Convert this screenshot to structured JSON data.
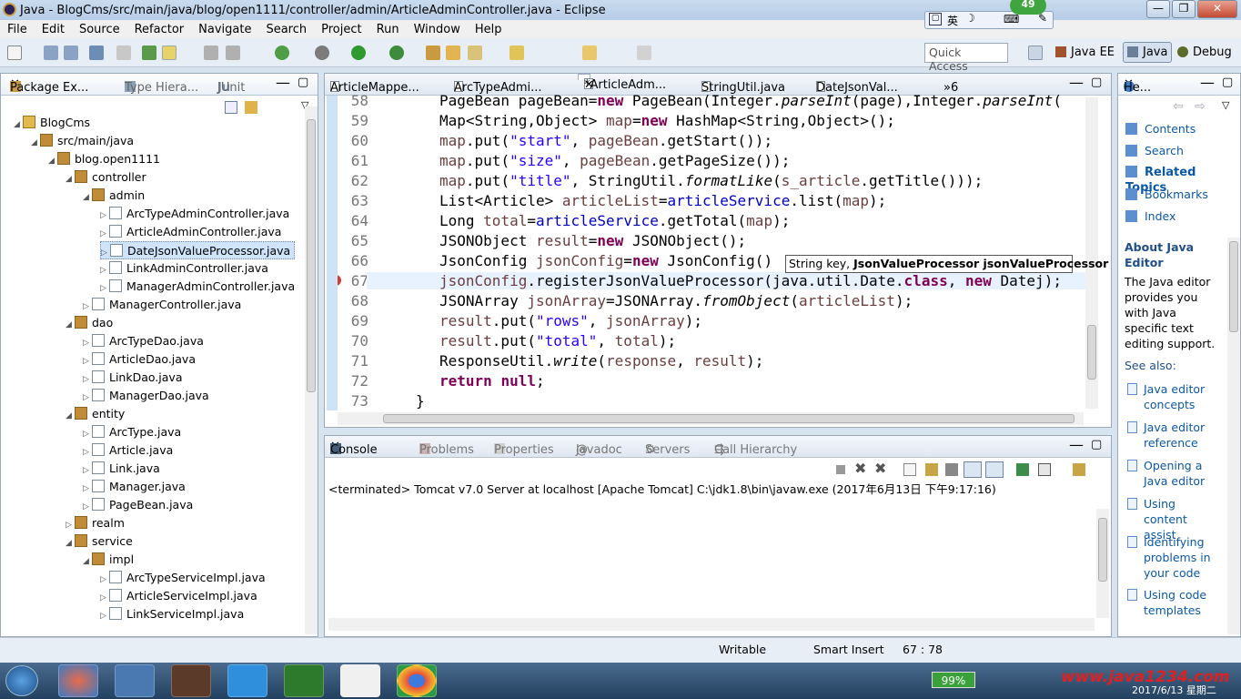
{
  "window": {
    "title": "Java - BlogCms/src/main/java/blog/open1111/controller/admin/ArticleAdminController.java - Eclipse"
  },
  "menu": [
    "File",
    "Edit",
    "Source",
    "Refactor",
    "Navigate",
    "Search",
    "Project",
    "Run",
    "Window",
    "Help"
  ],
  "quick_access": {
    "placeholder": "Quick Access"
  },
  "perspectives": [
    "Java EE",
    "Java",
    "Debug"
  ],
  "ime": {
    "label": "英",
    "badge": "49"
  },
  "package_explorer": {
    "tabs": [
      "Package Ex...",
      "Type Hiera...",
      "JUnit"
    ],
    "tree": [
      {
        "label": "BlogCms",
        "depth": 0,
        "kind": "proj",
        "open": true
      },
      {
        "label": "src/main/java",
        "depth": 1,
        "kind": "pkg",
        "open": true
      },
      {
        "label": "blog.open1111",
        "depth": 2,
        "kind": "pkg",
        "open": true
      },
      {
        "label": "controller",
        "depth": 3,
        "kind": "pkg",
        "open": true
      },
      {
        "label": "admin",
        "depth": 4,
        "kind": "pkg",
        "open": true
      },
      {
        "label": "ArcTypeAdminController.java",
        "depth": 5,
        "kind": "jf"
      },
      {
        "label": "ArticleAdminController.java",
        "depth": 5,
        "kind": "jf"
      },
      {
        "label": "DateJsonValueProcessor.java",
        "depth": 5,
        "kind": "jf",
        "selected": true
      },
      {
        "label": "LinkAdminController.java",
        "depth": 5,
        "kind": "jf"
      },
      {
        "label": "ManagerAdminController.java",
        "depth": 5,
        "kind": "jf"
      },
      {
        "label": "ManagerController.java",
        "depth": 4,
        "kind": "jf"
      },
      {
        "label": "dao",
        "depth": 3,
        "kind": "pkg",
        "open": true
      },
      {
        "label": "ArcTypeDao.java",
        "depth": 4,
        "kind": "jf"
      },
      {
        "label": "ArticleDao.java",
        "depth": 4,
        "kind": "jf"
      },
      {
        "label": "LinkDao.java",
        "depth": 4,
        "kind": "jf"
      },
      {
        "label": "ManagerDao.java",
        "depth": 4,
        "kind": "jf"
      },
      {
        "label": "entity",
        "depth": 3,
        "kind": "pkg",
        "open": true
      },
      {
        "label": "ArcType.java",
        "depth": 4,
        "kind": "jf"
      },
      {
        "label": "Article.java",
        "depth": 4,
        "kind": "jf"
      },
      {
        "label": "Link.java",
        "depth": 4,
        "kind": "jf"
      },
      {
        "label": "Manager.java",
        "depth": 4,
        "kind": "jf"
      },
      {
        "label": "PageBean.java",
        "depth": 4,
        "kind": "jf"
      },
      {
        "label": "realm",
        "depth": 3,
        "kind": "pkg"
      },
      {
        "label": "service",
        "depth": 3,
        "kind": "pkg",
        "open": true
      },
      {
        "label": "impl",
        "depth": 4,
        "kind": "pkg",
        "open": true
      },
      {
        "label": "ArcTypeServiceImpl.java",
        "depth": 5,
        "kind": "jf"
      },
      {
        "label": "ArticleServiceImpl.java",
        "depth": 5,
        "kind": "jf"
      },
      {
        "label": "LinkServiceImpl.java",
        "depth": 5,
        "kind": "jf"
      }
    ]
  },
  "editor": {
    "tabs": [
      "ArticleMappe...",
      "ArcTypeAdmi...",
      "*ArticleAdm...",
      "StringUtil.java",
      "DateJsonVal...",
      "»6"
    ],
    "lines": [
      {
        "n": "58",
        "t": [
          [
            "PageBean pageBean=",
            "n"
          ],
          [
            "new",
            "kw"
          ],
          [
            " PageBean(Integer.",
            "n"
          ],
          [
            "parseInt",
            "it"
          ],
          [
            "(page),Integer.",
            "n"
          ],
          [
            "parseInt",
            "it"
          ],
          [
            "(",
            "n"
          ]
        ]
      },
      {
        "n": "59",
        "t": [
          [
            "Map<String,Object> ",
            "n"
          ],
          [
            "map",
            "lv"
          ],
          [
            "=",
            "n"
          ],
          [
            "new",
            "kw"
          ],
          [
            " HashMap<String,Object>();",
            "n"
          ]
        ]
      },
      {
        "n": "60",
        "t": [
          [
            "map",
            "lv"
          ],
          [
            ".put(",
            "n"
          ],
          [
            "\"start\"",
            "st"
          ],
          [
            ", ",
            "n"
          ],
          [
            "pageBean",
            "lv"
          ],
          [
            ".getStart());",
            "n"
          ]
        ]
      },
      {
        "n": "61",
        "t": [
          [
            "map",
            "lv"
          ],
          [
            ".put(",
            "n"
          ],
          [
            "\"size\"",
            "st"
          ],
          [
            ", ",
            "n"
          ],
          [
            "pageBean",
            "lv"
          ],
          [
            ".getPageSize());",
            "n"
          ]
        ]
      },
      {
        "n": "62",
        "t": [
          [
            "map",
            "lv"
          ],
          [
            ".put(",
            "n"
          ],
          [
            "\"title\"",
            "st"
          ],
          [
            ", StringUtil.",
            "n"
          ],
          [
            "formatLike",
            "it"
          ],
          [
            "(",
            "n"
          ],
          [
            "s_article",
            "lv"
          ],
          [
            ".getTitle()));",
            "n"
          ]
        ]
      },
      {
        "n": "63",
        "t": [
          [
            "List<Article> ",
            "n"
          ],
          [
            "articleList",
            "lv"
          ],
          [
            "=",
            "n"
          ],
          [
            "articleService",
            "fv"
          ],
          [
            ".list(",
            "n"
          ],
          [
            "map",
            "lv"
          ],
          [
            ");",
            "n"
          ]
        ]
      },
      {
        "n": "64",
        "t": [
          [
            "Long ",
            "n"
          ],
          [
            "total",
            "lv"
          ],
          [
            "=",
            "n"
          ],
          [
            "articleService",
            "fv"
          ],
          [
            ".getTotal(",
            "n"
          ],
          [
            "map",
            "lv"
          ],
          [
            ");",
            "n"
          ]
        ]
      },
      {
        "n": "65",
        "t": [
          [
            "JSONObject ",
            "n"
          ],
          [
            "result",
            "lv"
          ],
          [
            "=",
            "n"
          ],
          [
            "new",
            "kw"
          ],
          [
            " JSONObject();",
            "n"
          ]
        ]
      },
      {
        "n": "66",
        "t": [
          [
            "JsonConfig ",
            "n"
          ],
          [
            "jsonConfig",
            "lv"
          ],
          [
            "=",
            "n"
          ],
          [
            "new",
            "kw"
          ],
          [
            " JsonConfig()",
            "n"
          ]
        ]
      },
      {
        "n": "67",
        "t": [
          [
            "jsonConfig",
            "lv"
          ],
          [
            ".registerJsonValueProcessor(java.util.Date.",
            "n"
          ],
          [
            "class",
            "kw"
          ],
          [
            ", ",
            "n"
          ],
          [
            "new",
            "kw"
          ],
          [
            " Datej);",
            "n"
          ]
        ]
      },
      {
        "n": "68",
        "t": [
          [
            "JSONArray ",
            "n"
          ],
          [
            "jsonArray",
            "lv"
          ],
          [
            "=JSONArray.",
            "n"
          ],
          [
            "fromObject",
            "it"
          ],
          [
            "(",
            "n"
          ],
          [
            "articleList",
            "lv"
          ],
          [
            ");",
            "n"
          ]
        ]
      },
      {
        "n": "69",
        "t": [
          [
            "result",
            "lv"
          ],
          [
            ".put(",
            "n"
          ],
          [
            "\"rows\"",
            "st"
          ],
          [
            ", ",
            "n"
          ],
          [
            "jsonArray",
            "lv"
          ],
          [
            ");",
            "n"
          ]
        ]
      },
      {
        "n": "70",
        "t": [
          [
            "result",
            "lv"
          ],
          [
            ".put(",
            "n"
          ],
          [
            "\"total\"",
            "st"
          ],
          [
            ", ",
            "n"
          ],
          [
            "total",
            "lv"
          ],
          [
            ");",
            "n"
          ]
        ]
      },
      {
        "n": "71",
        "t": [
          [
            "ResponseUtil.",
            "n"
          ],
          [
            "write",
            "it"
          ],
          [
            "(",
            "n"
          ],
          [
            "response",
            "lv"
          ],
          [
            ", ",
            "n"
          ],
          [
            "result",
            "lv"
          ],
          [
            ");",
            "n"
          ]
        ]
      },
      {
        "n": "72",
        "t": [
          [
            "return",
            "kw"
          ],
          [
            " ",
            "n"
          ],
          [
            "null",
            "kw"
          ],
          [
            ";",
            "n"
          ]
        ]
      },
      {
        "n": "73",
        "t": [
          [
            "}",
            "n"
          ]
        ]
      }
    ],
    "hint_prefix": "String key, ",
    "hint_bold": "JsonValueProcessor jsonValueProcessor"
  },
  "console": {
    "tabs": [
      "Console",
      "Problems",
      "Properties",
      "Javadoc",
      "Servers",
      "Call Hierarchy"
    ],
    "status": "<terminated> Tomcat v7.0 Server at localhost [Apache Tomcat] C:\\jdk1.8\\bin\\javaw.exe (2017年6月13日 下午9:17:16)"
  },
  "help": {
    "tab": "He...",
    "links": [
      "Contents",
      "Search",
      "Related Topics",
      "Bookmarks",
      "Index"
    ],
    "title": "About Java Editor",
    "desc": "The Java editor provides you with Java specific text editing support.",
    "see_also": "See also:",
    "items": [
      "Java editor concepts",
      "Java editor reference",
      "Opening a Java editor",
      "Using content assist",
      "Identifying problems in your code",
      "Using code templates"
    ]
  },
  "statusbar": {
    "writable": "Writable",
    "mode": "Smart Insert",
    "pos": "67 : 78"
  },
  "taskbar": {
    "battery": "99%",
    "watermark": "www.java1234.com",
    "date": "2017/6/13 星期二"
  }
}
